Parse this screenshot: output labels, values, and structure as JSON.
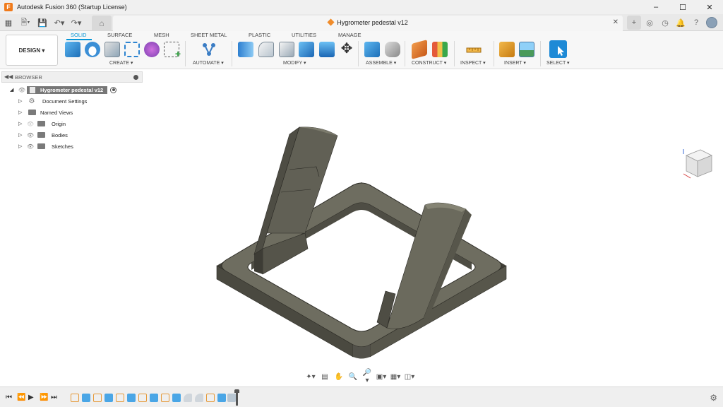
{
  "window": {
    "title": "Autodesk Fusion 360 (Startup License)",
    "minimize_icon": "minimize-icon",
    "maximize_icon": "maximize-icon",
    "close_icon": "close-icon"
  },
  "document": {
    "tab_title": "Hygrometer pedestal v12"
  },
  "toolbar": {
    "workspace": "DESIGN",
    "tabs": [
      "SOLID",
      "SURFACE",
      "MESH",
      "SHEET METAL",
      "PLASTIC",
      "UTILITIES",
      "MANAGE"
    ],
    "active_tab": "SOLID",
    "groups": [
      "CREATE",
      "AUTOMATE",
      "MODIFY",
      "ASSEMBLE",
      "CONSTRUCT",
      "INSPECT",
      "INSERT",
      "SELECT"
    ]
  },
  "browser": {
    "title": "BROWSER",
    "root": "Hygrometer pedestal v12",
    "items": [
      {
        "label": "Document Settings",
        "icon": "gear-icon"
      },
      {
        "label": "Named Views",
        "icon": "folder-icon"
      },
      {
        "label": "Origin",
        "icon": "folder-icon"
      },
      {
        "label": "Bodies",
        "icon": "folder-icon"
      },
      {
        "label": "Sketches",
        "icon": "folder-icon"
      }
    ]
  },
  "colors": {
    "accent": "#0696d7",
    "model_top": "#6f6e62",
    "model_side": "#4a4940",
    "brand": "#f07a1a"
  }
}
